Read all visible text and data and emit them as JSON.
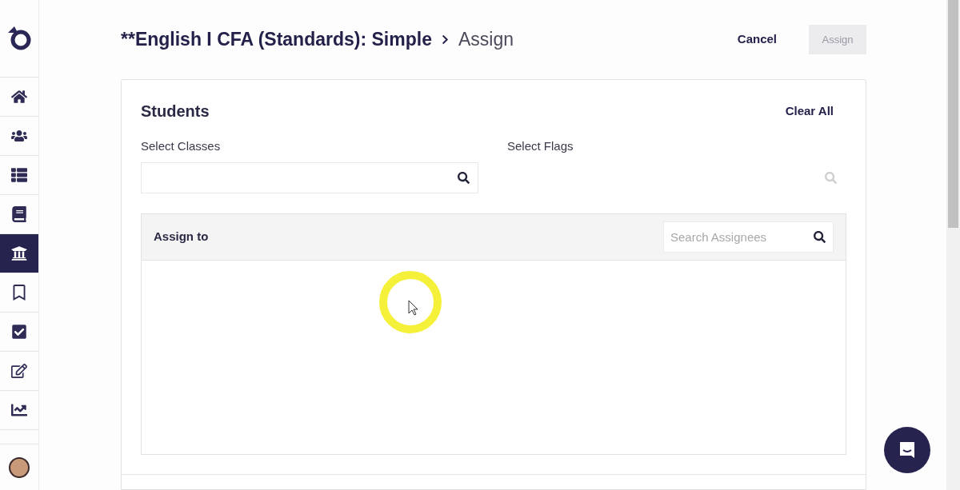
{
  "sidebar": {
    "items": [
      {
        "kind": "home",
        "selected": false
      },
      {
        "kind": "users",
        "selected": false
      },
      {
        "kind": "list",
        "selected": false
      },
      {
        "kind": "book",
        "selected": false
      },
      {
        "kind": "bank",
        "selected": true
      },
      {
        "kind": "bookmark",
        "selected": false
      },
      {
        "kind": "check",
        "selected": false
      },
      {
        "kind": "edit",
        "selected": false
      },
      {
        "kind": "chart",
        "selected": false
      }
    ]
  },
  "header": {
    "title": "**English I CFA (Standards): Simple",
    "current": "Assign",
    "cancel": "Cancel",
    "assign": {
      "label": "Assign",
      "disabled": true
    }
  },
  "students": {
    "title": "Students",
    "clear_all": "Clear All",
    "classes_label": "Select Classes",
    "flags_label": "Select Flags",
    "assign_to": {
      "title": "Assign to",
      "search": {
        "placeholder": "Search Assignees"
      }
    }
  }
}
